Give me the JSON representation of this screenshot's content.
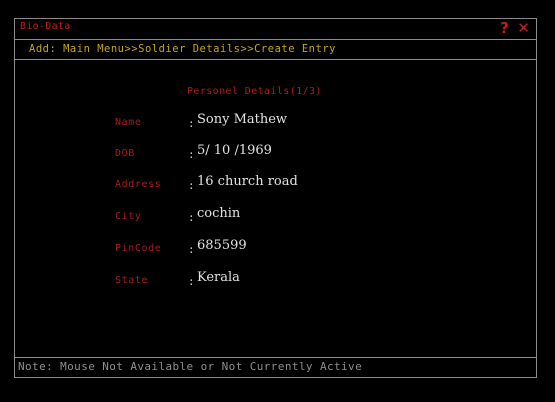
{
  "window": {
    "title": "Bio-Data",
    "help_glyph": "?",
    "close_glyph": "✕"
  },
  "breadcrumb": "Add: Main Menu>>Soldier Details>>Create Entry",
  "section_title": "Personel Details(1/3)",
  "colon": ":",
  "fields": [
    {
      "label": "Name",
      "value": "Sony Mathew"
    },
    {
      "label": "DOB",
      "value": "5/ 10 /1969"
    },
    {
      "label": "Address",
      "value": "16 church road"
    },
    {
      "label": "City",
      "value": "cochin"
    },
    {
      "label": "PinCode",
      "value": "685599"
    },
    {
      "label": "State",
      "value": "Kerala"
    }
  ],
  "status_note": "Note: Mouse Not Available or Not Currently Active",
  "colors": {
    "background": "#000000",
    "title": "#c41c1c",
    "breadcrumb": "#c2a61e",
    "label": "#a81a1a",
    "value": "#e2e2e2",
    "border": "#8a8a8a",
    "note": "#8e8e8e"
  }
}
